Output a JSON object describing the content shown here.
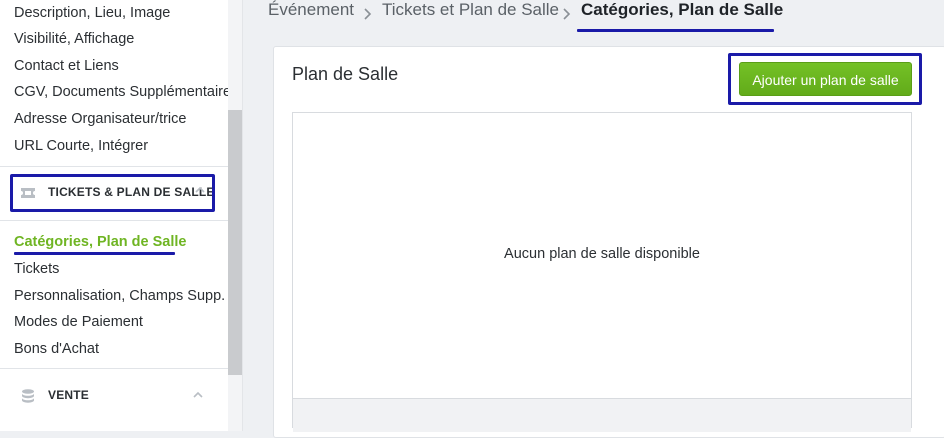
{
  "sidebar": {
    "top_items": [
      {
        "label": "Description, Lieu, Image"
      },
      {
        "label": "Visibilité, Affichage"
      },
      {
        "label": "Contact et Liens"
      },
      {
        "label": "CGV, Documents Supplémentaires"
      },
      {
        "label": "Adresse Organisateur/trice"
      },
      {
        "label": "URL Courte, Intégrer"
      }
    ],
    "tickets_section": {
      "label": "TICKETS & PLAN DE SALLE",
      "icon": "ticket-icon",
      "expanded": true
    },
    "ticket_items": [
      {
        "label": "Catégories, Plan de Salle",
        "active": true
      },
      {
        "label": "Tickets"
      },
      {
        "label": "Personnalisation, Champs Supp."
      },
      {
        "label": "Modes de Paiement"
      },
      {
        "label": "Bons d'Achat"
      }
    ],
    "vente_section": {
      "label": "VENTE",
      "icon": "database-icon"
    }
  },
  "breadcrumb": {
    "items": [
      "Événement",
      "Tickets et Plan de Salle",
      "Catégories, Plan de Salle"
    ]
  },
  "card": {
    "title": "Plan de Salle",
    "add_button_label": "Ajouter un plan de salle",
    "empty_message": "Aucun plan de salle disponible"
  },
  "colors": {
    "accent_green": "#6fb523",
    "button_green": "#68b21f",
    "highlight_blue": "#1a1aa8"
  }
}
